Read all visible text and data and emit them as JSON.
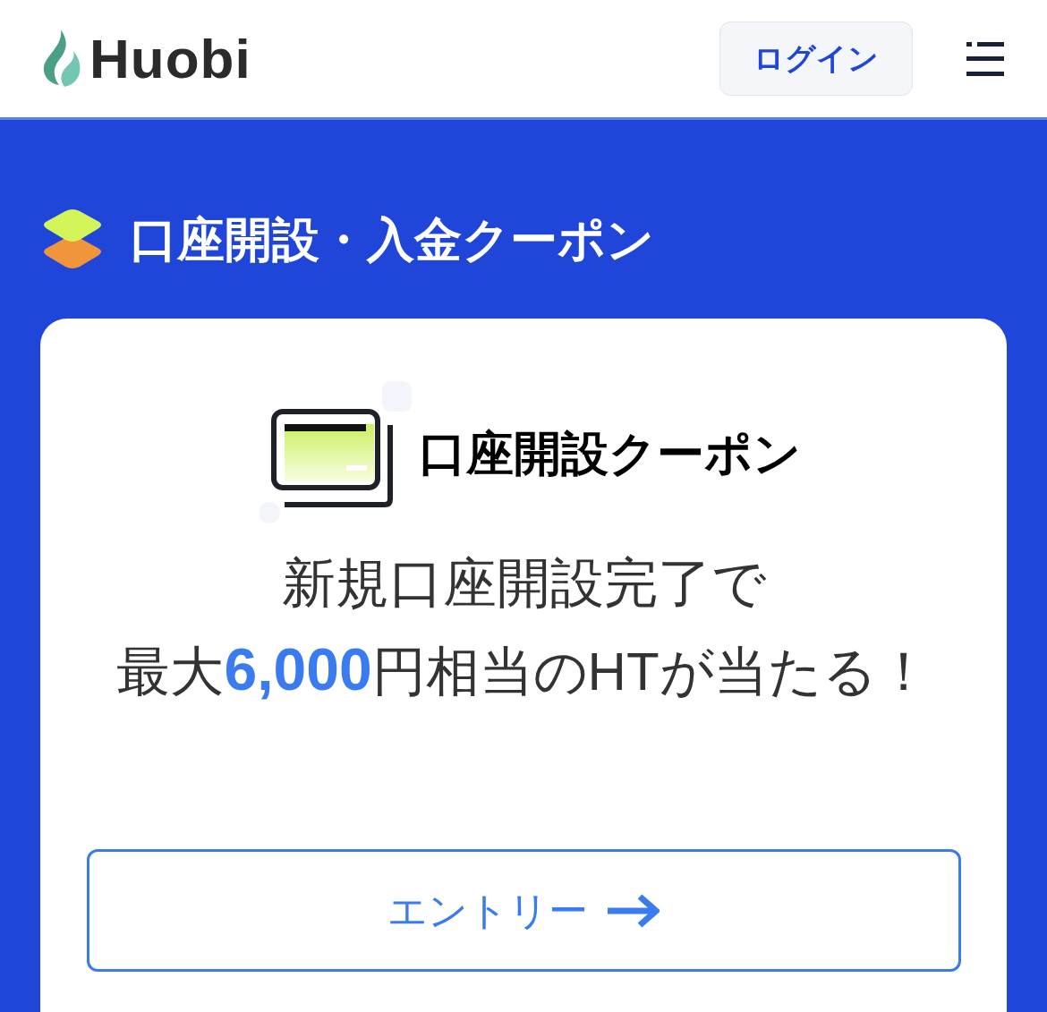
{
  "header": {
    "logo_text": "Huobi",
    "login_button": "ログイン"
  },
  "section": {
    "title": "口座開設・入金クーポン"
  },
  "coupon_card": {
    "title": "口座開設クーポン",
    "description": [
      [
        {
          "text": "新規口座開設完了で",
          "kind": "plain"
        }
      ],
      [
        {
          "text": "最大",
          "kind": "plain"
        },
        {
          "text": "6,000",
          "kind": "highlight"
        },
        {
          "text": "円相当のHTが当たる！",
          "kind": "plain"
        }
      ]
    ],
    "entry_button": "エントリー"
  }
}
